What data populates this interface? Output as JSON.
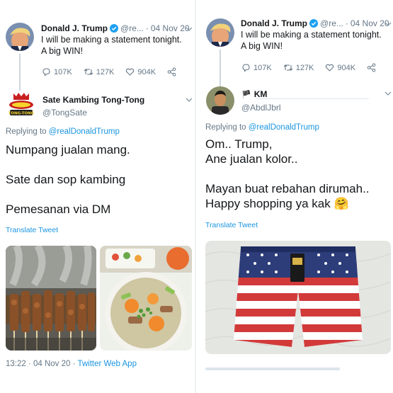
{
  "colors": {
    "link": "#1b95e0",
    "muted": "#657786",
    "text": "#14171a",
    "verified": "#1da1f2"
  },
  "quoted_tweet": {
    "name": "Donald J. Trump",
    "handle_truncated": "@re...",
    "separator": "·",
    "date": "04 Nov 20",
    "text": "I will be making a statement tonight. A big WIN!",
    "replies": "107K",
    "retweets": "127K",
    "likes": "904K"
  },
  "left_reply": {
    "name": "Sate Kambing Tong-Tong",
    "handle": "@TongSate",
    "replying_prefix": "Replying to",
    "replying_to": "@realDonaldTrump",
    "lines": [
      "Numpang jualan mang.",
      "",
      "Sate dan sop kambing",
      "",
      "Pemesanan via DM"
    ],
    "translate": "Translate Tweet",
    "footer_time": "13:22 · 04 Nov 20 ·",
    "footer_app": "Twitter Web App",
    "logo_text": "TONG-TONG"
  },
  "right_reply": {
    "flag": "🏴",
    "name": "KM",
    "handle": "@AbdlJbrl",
    "replying_prefix": "Replying to",
    "replying_to": "@realDonaldTrump",
    "lines": [
      "Om.. Trump,",
      "Ane jualan kolor..",
      "",
      "Mayan buat rebahan dirumah..",
      "Happy shopping ya kak 🤗"
    ],
    "translate": "Translate Tweet"
  }
}
